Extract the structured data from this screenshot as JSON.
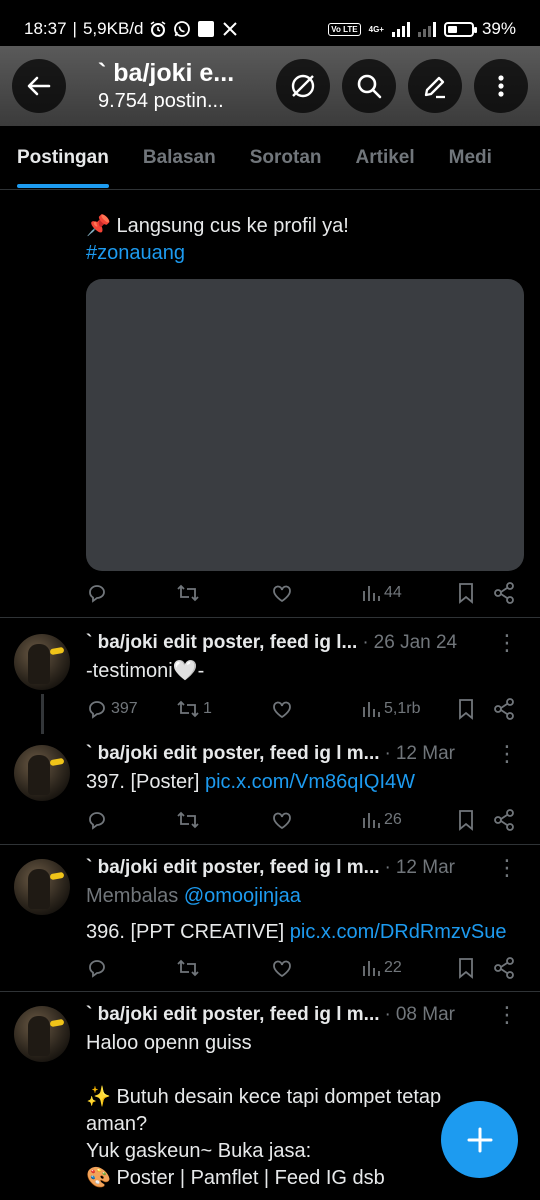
{
  "status_bar": {
    "time": "18:37",
    "separator": "|",
    "net_speed": "5,9KB/d",
    "net_type": "4G+",
    "volte": "Vo LTE",
    "battery": "39%",
    "battery_level": 0.39
  },
  "header": {
    "title": "` ba/joki e...",
    "subtitle": "9.754 postin..."
  },
  "tabs": [
    {
      "label": "Postingan",
      "active": true
    },
    {
      "label": "Balasan"
    },
    {
      "label": "Sorotan"
    },
    {
      "label": "Artikel"
    },
    {
      "label": "Medi"
    }
  ],
  "posts": [
    {
      "line1_emoji": "📌",
      "line1": "Langsung cus ke profil ya!",
      "hashtag": "#zonauang",
      "views": "44"
    },
    {
      "name": "` ba/joki edit poster, feed ig l...",
      "date": "26 Jan 24",
      "text": "-testimoni🤍-",
      "replies": "397",
      "retweets": "1",
      "views": "5,1rb"
    },
    {
      "name": "` ba/joki edit poster, feed ig l m...",
      "date": "12 Mar",
      "text": "397.  [Poster]",
      "link": "pic.x.com/Vm86qIQI4W",
      "views": "26"
    },
    {
      "name": "` ba/joki edit poster, feed ig l m...",
      "date": "12 Mar",
      "reply_prefix": "Membalas",
      "reply_to": "@omoojinjaa",
      "text": "396.  [PPT CREATIVE]",
      "link": "pic.x.com/DRdRmzvSue",
      "views": "22"
    },
    {
      "name": "` ba/joki edit poster, feed ig l m...",
      "date": "08 Mar",
      "line1": "Haloo openn guiss",
      "line2": "✨ Butuh desain kece tapi dompet tetap aman?",
      "line3": "Yuk gaskeun~ Buka jasa:",
      "line4": "🎨 Poster | Pamflet | Feed IG dsb"
    }
  ],
  "colors": {
    "accent": "#1d9bf0",
    "muted": "#71767b",
    "divider": "#2f3336"
  }
}
